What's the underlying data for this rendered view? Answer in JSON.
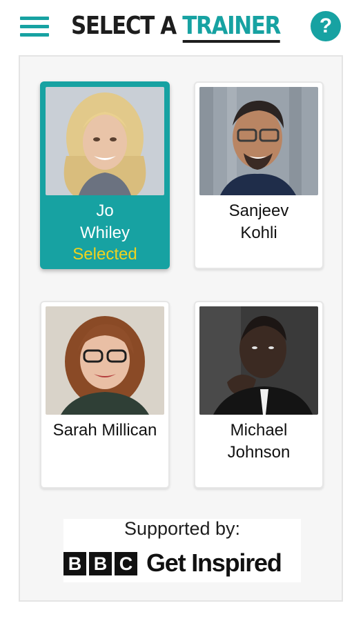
{
  "header": {
    "title_part1": "SELECT A ",
    "title_part2": "TRAINER",
    "menu_icon": "hamburger-menu-icon",
    "help_icon": "question-mark-icon",
    "help_label": "?"
  },
  "colors": {
    "accent": "#17a2a2",
    "selected_text": "#f0d21e",
    "dark": "#1d1d1d"
  },
  "trainers": [
    {
      "first": "Jo",
      "last": "Whiley",
      "status": "Selected",
      "selected": true
    },
    {
      "first": "Sanjeev",
      "last": "Kohli",
      "status": "",
      "selected": false
    },
    {
      "first": "Sarah Millican",
      "last": "",
      "status": "",
      "selected": false
    },
    {
      "first": "Michael",
      "last": "Johnson",
      "status": "",
      "selected": false
    }
  ],
  "supported": {
    "label": "Supported by:",
    "logo_letters": [
      "B",
      "B",
      "C"
    ],
    "logo_text": "Get Inspired"
  }
}
